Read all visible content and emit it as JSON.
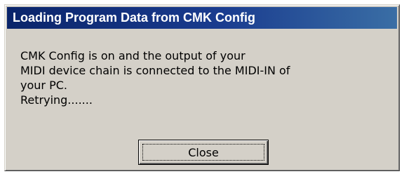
{
  "dialog": {
    "title": "Loading Program Data from CMK Config",
    "message_lines": [
      "CMK Config is on and the output of your",
      "MIDI device chain is connected to the MIDI-IN of",
      "your PC.",
      "Retrying......."
    ],
    "close_label": "Close"
  },
  "colors": {
    "title_bar": "#0a246a",
    "dialog_face": "#d4d0c8"
  }
}
